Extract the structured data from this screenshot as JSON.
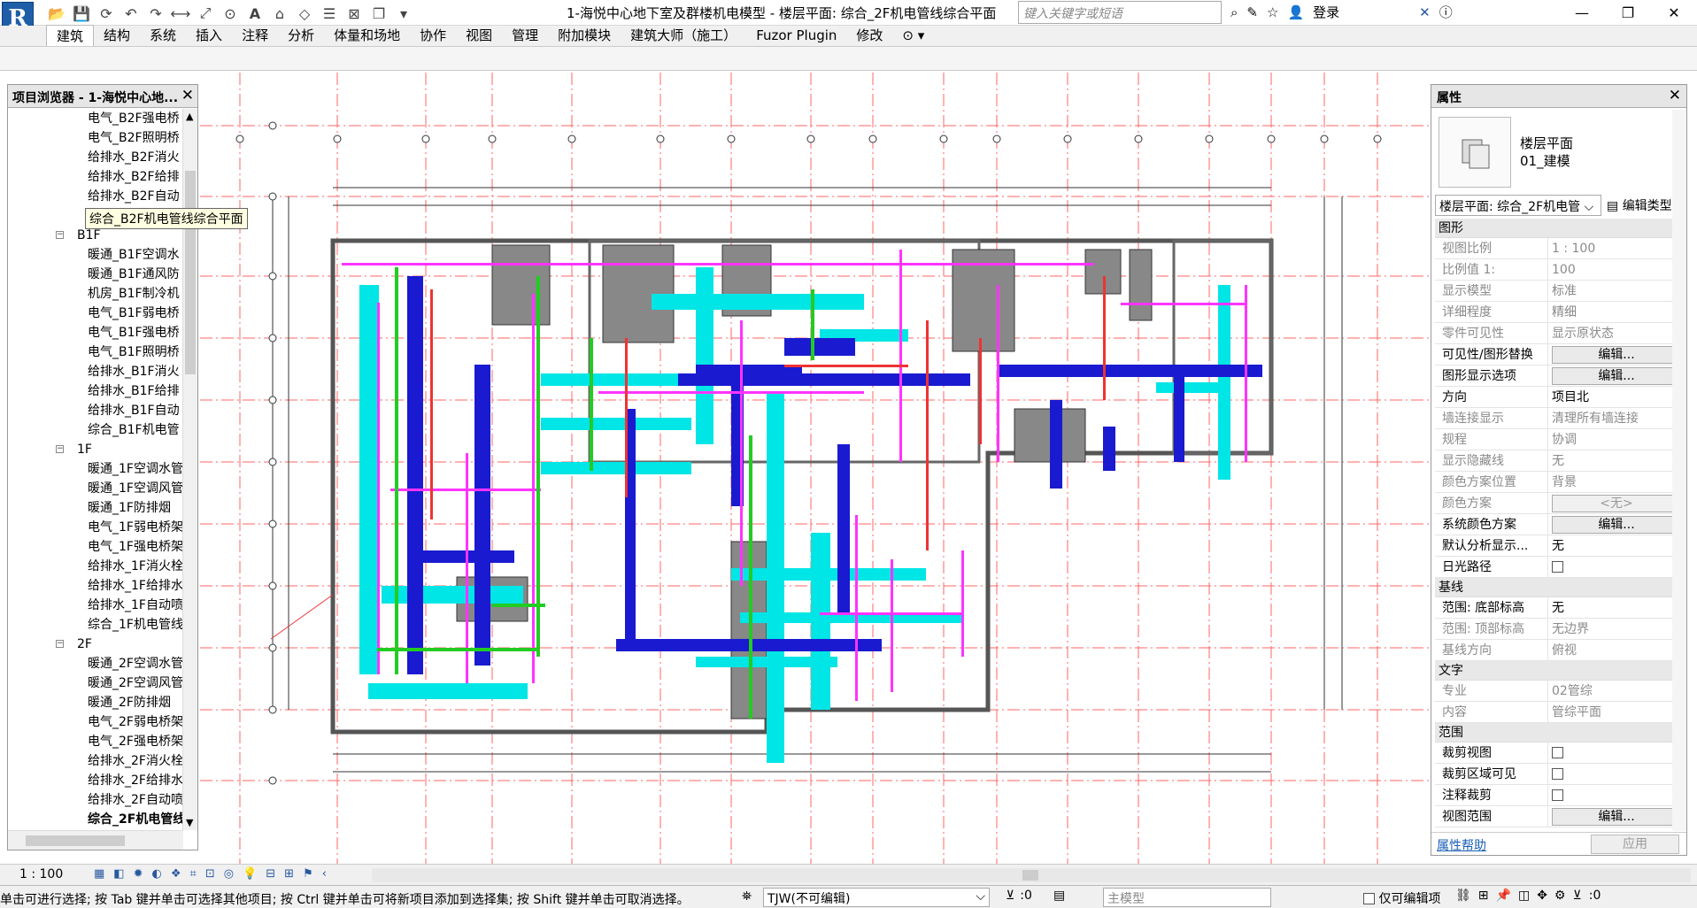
{
  "window": {
    "title": "1-海悦中心地下室及群楼机电模型 - 楼层平面: 综合_2F机电管线综合平面",
    "search_placeholder": "键入关键字或短语",
    "login": "登录"
  },
  "ribbon": {
    "tabs": [
      "建筑",
      "结构",
      "系统",
      "插入",
      "注释",
      "分析",
      "体量和场地",
      "协作",
      "视图",
      "管理",
      "附加模块",
      "建筑大师（施工）",
      "Fuzor Plugin",
      "修改"
    ]
  },
  "browser": {
    "title": "项目浏览器 - 1-海悦中心地...",
    "tooltip": "综合_B2F机电管线综合平面",
    "items": [
      {
        "type": "leaf",
        "label": "电气_B2F强电桥"
      },
      {
        "type": "leaf",
        "label": "电气_B2F照明桥"
      },
      {
        "type": "leaf",
        "label": "给排水_B2F消火"
      },
      {
        "type": "leaf",
        "label": "给排水_B2F给排"
      },
      {
        "type": "leaf",
        "label": "给排水_B2F自动"
      },
      {
        "type": "leaf",
        "label": ""
      },
      {
        "type": "grp",
        "label": "B1F"
      },
      {
        "type": "leaf",
        "label": "暖通_B1F空调水"
      },
      {
        "type": "leaf",
        "label": "暖通_B1F通风防"
      },
      {
        "type": "leaf",
        "label": "机房_B1F制冷机"
      },
      {
        "type": "leaf",
        "label": "电气_B1F弱电桥"
      },
      {
        "type": "leaf",
        "label": "电气_B1F强电桥"
      },
      {
        "type": "leaf",
        "label": "电气_B1F照明桥"
      },
      {
        "type": "leaf",
        "label": "给排水_B1F消火"
      },
      {
        "type": "leaf",
        "label": "给排水_B1F给排"
      },
      {
        "type": "leaf",
        "label": "给排水_B1F自动"
      },
      {
        "type": "leaf",
        "label": "综合_B1F机电管"
      },
      {
        "type": "grp",
        "label": "1F"
      },
      {
        "type": "leaf",
        "label": "暖通_1F空调水管"
      },
      {
        "type": "leaf",
        "label": "暖通_1F空调风管"
      },
      {
        "type": "leaf",
        "label": "暖通_1F防排烟"
      },
      {
        "type": "leaf",
        "label": "电气_1F弱电桥架"
      },
      {
        "type": "leaf",
        "label": "电气_1F强电桥架"
      },
      {
        "type": "leaf",
        "label": "给排水_1F消火栓"
      },
      {
        "type": "leaf",
        "label": "给排水_1F给排水"
      },
      {
        "type": "leaf",
        "label": "给排水_1F自动喷"
      },
      {
        "type": "leaf",
        "label": "综合_1F机电管线"
      },
      {
        "type": "grp",
        "label": "2F"
      },
      {
        "type": "leaf",
        "label": "暖通_2F空调水管"
      },
      {
        "type": "leaf",
        "label": "暖通_2F空调风管"
      },
      {
        "type": "leaf",
        "label": "暖通_2F防排烟"
      },
      {
        "type": "leaf",
        "label": "电气_2F弱电桥架"
      },
      {
        "type": "leaf",
        "label": "电气_2F强电桥架"
      },
      {
        "type": "leaf",
        "label": "给排水_2F消火栓"
      },
      {
        "type": "leaf",
        "label": "给排水_2F给排水"
      },
      {
        "type": "leaf",
        "label": "给排水_2F自动喷"
      },
      {
        "type": "leaf",
        "label": "综合_2F机电管线",
        "bold": true
      }
    ]
  },
  "properties": {
    "title": "属性",
    "type_line1": "楼层平面",
    "type_line2": "01_建模",
    "instance": "楼层平面: 综合_2F机电管",
    "edit_type": "编辑类型",
    "sections": [
      {
        "name": "图形",
        "rows": [
          {
            "k": "视图比例",
            "v": "1 : 100",
            "grey": true
          },
          {
            "k": "比例值 1:",
            "v": "100",
            "grey": true
          },
          {
            "k": "显示模型",
            "v": "标准",
            "grey": true
          },
          {
            "k": "详细程度",
            "v": "精细",
            "grey": true
          },
          {
            "k": "零件可见性",
            "v": "显示原状态",
            "grey": true
          },
          {
            "k": "可见性/图形替换",
            "v": "编辑...",
            "btn": true
          },
          {
            "k": "图形显示选项",
            "v": "编辑...",
            "btn": true
          },
          {
            "k": "方向",
            "v": "项目北"
          },
          {
            "k": "墙连接显示",
            "v": "清理所有墙连接",
            "grey": true
          },
          {
            "k": "规程",
            "v": "协调",
            "grey": true
          },
          {
            "k": "显示隐藏线",
            "v": "无",
            "grey": true
          },
          {
            "k": "颜色方案位置",
            "v": "背景",
            "grey": true
          },
          {
            "k": "颜色方案",
            "v": "<无>",
            "grey": true,
            "btn": true,
            "dis": true
          },
          {
            "k": "系统颜色方案",
            "v": "编辑...",
            "btn": true
          },
          {
            "k": "默认分析显示...",
            "v": "无"
          },
          {
            "k": "日光路径",
            "v": "",
            "cb": true
          }
        ]
      },
      {
        "name": "基线",
        "rows": [
          {
            "k": "范围: 底部标高",
            "v": "无"
          },
          {
            "k": "范围: 顶部标高",
            "v": "无边界",
            "grey": true
          },
          {
            "k": "基线方向",
            "v": "俯视",
            "grey": true
          }
        ]
      },
      {
        "name": "文字",
        "rows": [
          {
            "k": "专业",
            "v": "02管综",
            "grey": true
          },
          {
            "k": "内容",
            "v": "管综平面",
            "grey": true
          }
        ]
      },
      {
        "name": "范围",
        "rows": [
          {
            "k": "裁剪视图",
            "v": "",
            "cb": true
          },
          {
            "k": "裁剪区域可见",
            "v": "",
            "cb": true
          },
          {
            "k": "注释裁剪",
            "v": "",
            "cb": true
          },
          {
            "k": "视图范围",
            "v": "编辑...",
            "btn": true
          }
        ]
      }
    ],
    "help": "属性帮助",
    "apply": "应用"
  },
  "viewbar": {
    "scale": "1 : 100"
  },
  "status": {
    "message": "单击可进行选择; 按 Tab 键并单击可选择其他项目; 按 Ctrl 键并单击可将新项目添加到选择集; 按 Shift 键并单击可取消选择。",
    "workset": "TJW(不可编辑)",
    "sel_count": ":0",
    "main_model": "主模型",
    "editable_only": "仅可编辑项",
    "filter_count": ":0"
  },
  "colors": {
    "cyan": "#00e5e5",
    "blue": "#1a1ad0",
    "magenta": "#ff33ff",
    "green": "#22cc22",
    "red": "#ee3333",
    "grid": "#ff6666"
  }
}
